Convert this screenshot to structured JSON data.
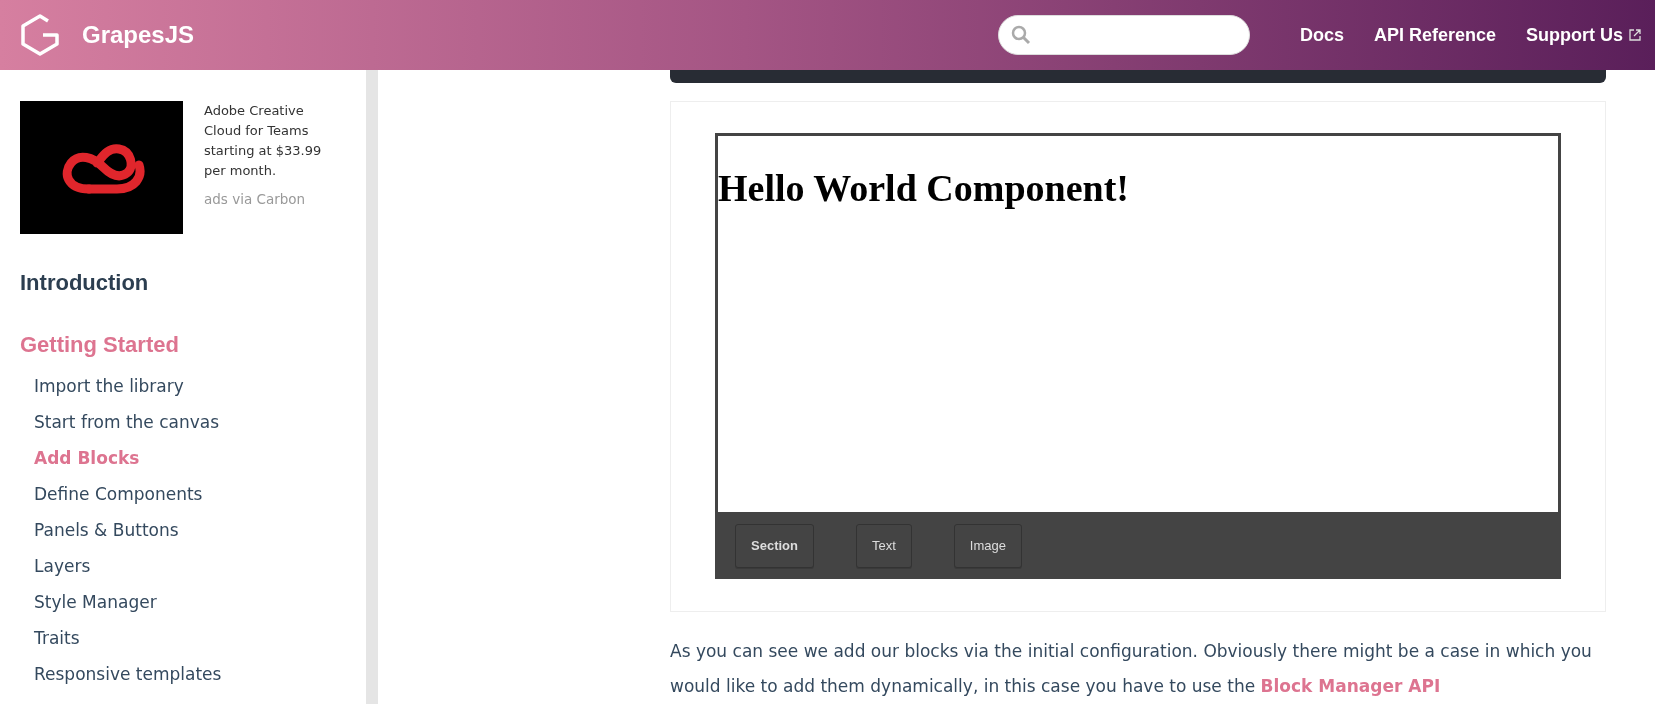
{
  "header": {
    "brand": "GrapesJS",
    "nav": [
      {
        "label": "Docs",
        "external": false
      },
      {
        "label": "API Reference",
        "external": false
      },
      {
        "label": "Support Us",
        "external": true
      }
    ]
  },
  "sidebar": {
    "ad": {
      "text": "Adobe Creative Cloud for Teams starting at $33.99 per month.",
      "via": "ads via Carbon"
    },
    "sections": [
      {
        "title": "Introduction",
        "selected": false
      },
      {
        "title": "Getting Started",
        "selected": true,
        "items": [
          {
            "label": "Import the library",
            "selected": false
          },
          {
            "label": "Start from the canvas",
            "selected": false
          },
          {
            "label": "Add Blocks",
            "selected": true
          },
          {
            "label": "Define Components",
            "selected": false
          },
          {
            "label": "Panels & Buttons",
            "selected": false
          },
          {
            "label": "Layers",
            "selected": false
          },
          {
            "label": "Style Manager",
            "selected": false
          },
          {
            "label": "Traits",
            "selected": false
          },
          {
            "label": "Responsive templates",
            "selected": false
          }
        ]
      }
    ]
  },
  "demo": {
    "heading": "Hello World Component!",
    "blocks": [
      {
        "label": "Section",
        "bold": true
      },
      {
        "label": "Text",
        "bold": false
      },
      {
        "label": "Image",
        "bold": false
      }
    ]
  },
  "paragraph": {
    "text": "As you can see we add our blocks via the initial configuration. Obviously there might be a case in which you would like to add them dynamically, in this case you have to use the ",
    "link": "Block Manager API"
  }
}
